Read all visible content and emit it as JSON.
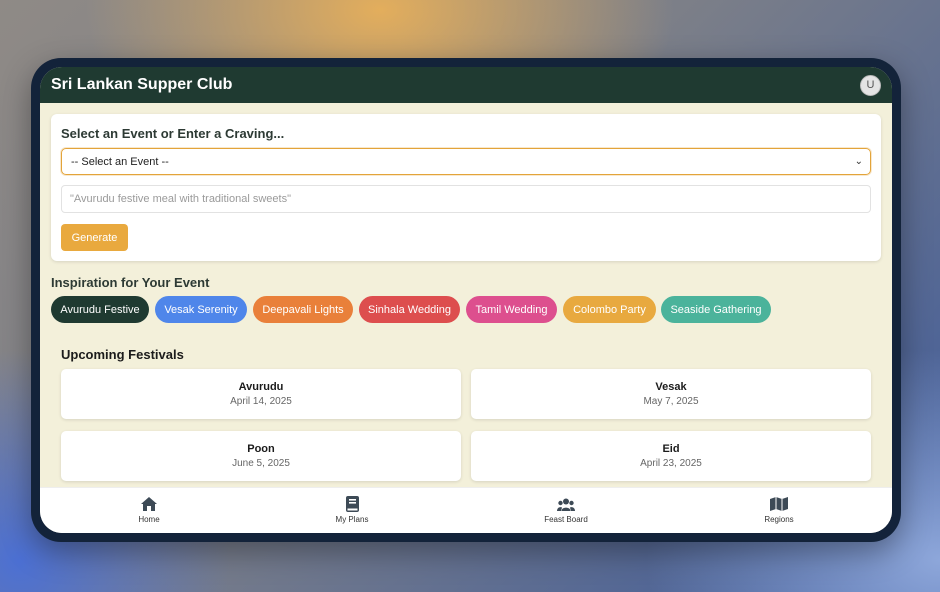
{
  "app": {
    "title": "Sri Lankan Supper Club",
    "avatar_initial": "U"
  },
  "event_form": {
    "heading": "Select an Event or Enter a Craving...",
    "select_value": "-- Select an Event --",
    "craving_placeholder": "\"Avurudu festive meal with traditional sweets\"",
    "generate_label": "Generate"
  },
  "inspiration": {
    "heading": "Inspiration for Your Event",
    "chips": [
      {
        "label": "Avurudu Festive",
        "color": "#1f3a31"
      },
      {
        "label": "Vesak Serenity",
        "color": "#4f86ea"
      },
      {
        "label": "Deepavali Lights",
        "color": "#e9803a"
      },
      {
        "label": "Sinhala Wedding",
        "color": "#dd4e4e"
      },
      {
        "label": "Tamil Wedding",
        "color": "#dd4f8e"
      },
      {
        "label": "Colombo Party",
        "color": "#e8a93f"
      },
      {
        "label": "Seaside Gathering",
        "color": "#4bb39b"
      }
    ]
  },
  "festivals": {
    "heading": "Upcoming Festivals",
    "items": [
      {
        "name": "Avurudu",
        "date": "April 14, 2025"
      },
      {
        "name": "Vesak",
        "date": "May 7, 2025"
      },
      {
        "name": "Poon",
        "date": "June 5, 2025"
      },
      {
        "name": "Eid",
        "date": "April 23, 2025"
      }
    ]
  },
  "nav": {
    "items": [
      {
        "label": "Home",
        "icon": "home-icon"
      },
      {
        "label": "My Plans",
        "icon": "book-icon"
      },
      {
        "label": "Feast Board",
        "icon": "users-icon"
      },
      {
        "label": "Regions",
        "icon": "map-icon"
      }
    ]
  }
}
